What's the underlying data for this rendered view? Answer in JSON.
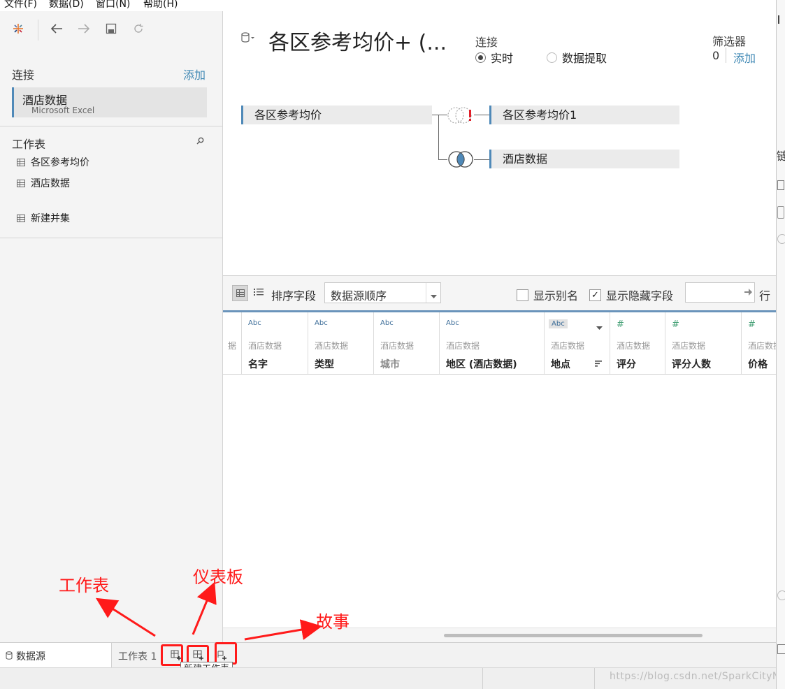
{
  "menubar": {
    "items": [
      "文件(F)",
      "数据(D)",
      "窗口(N)",
      "帮助(H)"
    ]
  },
  "toolbar": {
    "back": "back-arrow",
    "forward": "forward-arrow",
    "save": "save-icon",
    "refresh": "refresh-icon"
  },
  "left": {
    "connections_title": "连接",
    "add_label": "添加",
    "connection": {
      "name": "酒店数据",
      "type": "Microsoft Excel"
    },
    "sheets_title": "工作表",
    "sheets": [
      "各区参考均价",
      "酒店数据"
    ],
    "new_union": "新建并集"
  },
  "datasource": {
    "title": "各区参考均价+ (...",
    "connection_label": "连接",
    "live_label": "实时",
    "extract_label": "数据提取",
    "filters_label": "筛选器",
    "filters_count": "0",
    "filters_add": "添加"
  },
  "relations": {
    "left_table": "各区参考均价",
    "right_tables": [
      "各区参考均价1",
      "酒店数据"
    ]
  },
  "grid": {
    "sort_label": "排序字段",
    "sort_value": "数据源顺序",
    "show_alias": "显示别名",
    "show_hidden": "显示隐藏字段",
    "rows_label": "行",
    "prev_stub": "据",
    "columns": [
      {
        "type": "Abc",
        "source": "酒店数据",
        "name": "名字"
      },
      {
        "type": "Abc",
        "source": "酒店数据",
        "name": "类型"
      },
      {
        "type": "Abc",
        "source": "酒店数据",
        "name": "城市"
      },
      {
        "type": "Abc",
        "source": "酒店数据",
        "name": "地区 (酒店数据)"
      },
      {
        "type": "Abc",
        "source": "酒店数据",
        "name": "地点"
      },
      {
        "type": "#",
        "source": "酒店数据",
        "name": "评分"
      },
      {
        "type": "#",
        "source": "酒店数据",
        "name": "评分人数"
      },
      {
        "type": "#",
        "source": "酒店数据",
        "name": "价格"
      }
    ]
  },
  "bottom": {
    "datasource_tab": "数据源",
    "sheet_tab": "工作表 1",
    "tooltip": "新建工作表"
  },
  "annotations": {
    "worksheet": "工作表",
    "dashboard": "仪表板",
    "story": "故事"
  },
  "status": {
    "watermark": "https://blog.csdn.net/SparkCityNet"
  },
  "right_edge": {
    "glyph_1": "链"
  },
  "colors": {
    "accent": "#3f88b4",
    "annotation": "#ff1a1a",
    "join_blue": "#4f89b8"
  }
}
